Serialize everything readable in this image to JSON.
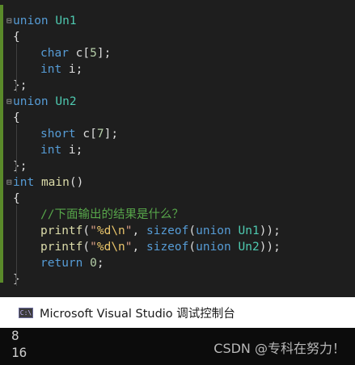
{
  "code_lines": [
    {
      "parts": [
        [
          "kw",
          "union"
        ],
        [
          "punc",
          " "
        ],
        [
          "type",
          "Un1"
        ]
      ],
      "fold": true
    },
    {
      "parts": [
        [
          "punc",
          "{"
        ]
      ]
    },
    {
      "parts": [
        [
          "ind",
          ""
        ],
        [
          "kw",
          "char"
        ],
        [
          "var",
          " c"
        ],
        [
          "punc",
          "["
        ],
        [
          "num",
          "5"
        ],
        [
          "punc",
          "];"
        ]
      ]
    },
    {
      "parts": [
        [
          "ind",
          ""
        ],
        [
          "kw",
          "int"
        ],
        [
          "var",
          " i"
        ],
        [
          "punc",
          ";"
        ]
      ]
    },
    {
      "parts": [
        [
          "punc",
          "};"
        ]
      ]
    },
    {
      "parts": [
        [
          "kw",
          "union"
        ],
        [
          "punc",
          " "
        ],
        [
          "type",
          "Un2"
        ]
      ],
      "fold": true
    },
    {
      "parts": [
        [
          "punc",
          "{"
        ]
      ]
    },
    {
      "parts": [
        [
          "ind",
          ""
        ],
        [
          "kw",
          "short"
        ],
        [
          "var",
          " c"
        ],
        [
          "punc",
          "["
        ],
        [
          "num",
          "7"
        ],
        [
          "punc",
          "];"
        ]
      ]
    },
    {
      "parts": [
        [
          "ind",
          ""
        ],
        [
          "kw",
          "int"
        ],
        [
          "var",
          " i"
        ],
        [
          "punc",
          ";"
        ]
      ]
    },
    {
      "parts": [
        [
          "punc",
          "};"
        ]
      ]
    },
    {
      "parts": [
        [
          "kw",
          "int"
        ],
        [
          "punc",
          " "
        ],
        [
          "fn",
          "main"
        ],
        [
          "punc",
          "()"
        ]
      ],
      "fold": true
    },
    {
      "parts": [
        [
          "punc",
          "{"
        ]
      ]
    },
    {
      "parts": [
        [
          "ind",
          ""
        ],
        [
          "cmt",
          "//下面输出的结果是什么？"
        ]
      ]
    },
    {
      "parts": [
        [
          "ind",
          ""
        ],
        [
          "fn",
          "printf"
        ],
        [
          "punc",
          "("
        ],
        [
          "str",
          "\""
        ],
        [
          "esc",
          "%d\\n"
        ],
        [
          "str",
          "\""
        ],
        [
          "punc",
          ", "
        ],
        [
          "kw",
          "sizeof"
        ],
        [
          "punc",
          "("
        ],
        [
          "kw",
          "union"
        ],
        [
          "punc",
          " "
        ],
        [
          "type",
          "Un1"
        ],
        [
          "punc",
          "));"
        ]
      ]
    },
    {
      "parts": [
        [
          "ind",
          ""
        ],
        [
          "fn",
          "printf"
        ],
        [
          "punc",
          "("
        ],
        [
          "str",
          "\""
        ],
        [
          "esc",
          "%d\\n"
        ],
        [
          "str",
          "\""
        ],
        [
          "punc",
          ", "
        ],
        [
          "kw",
          "sizeof"
        ],
        [
          "punc",
          "("
        ],
        [
          "kw",
          "union"
        ],
        [
          "punc",
          " "
        ],
        [
          "type",
          "Un2"
        ],
        [
          "punc",
          "));"
        ]
      ]
    },
    {
      "parts": [
        [
          "ind",
          ""
        ],
        [
          "kw",
          "return"
        ],
        [
          "punc",
          " "
        ],
        [
          "num",
          "0"
        ],
        [
          "punc",
          ";"
        ]
      ]
    },
    {
      "parts": [
        [
          "punc",
          "}"
        ]
      ]
    }
  ],
  "console": {
    "icon_label": "C:\\",
    "title": "Microsoft Visual Studio 调试控制台",
    "output": [
      "8",
      "16"
    ]
  },
  "watermark": "CSDN @专科在努力！"
}
